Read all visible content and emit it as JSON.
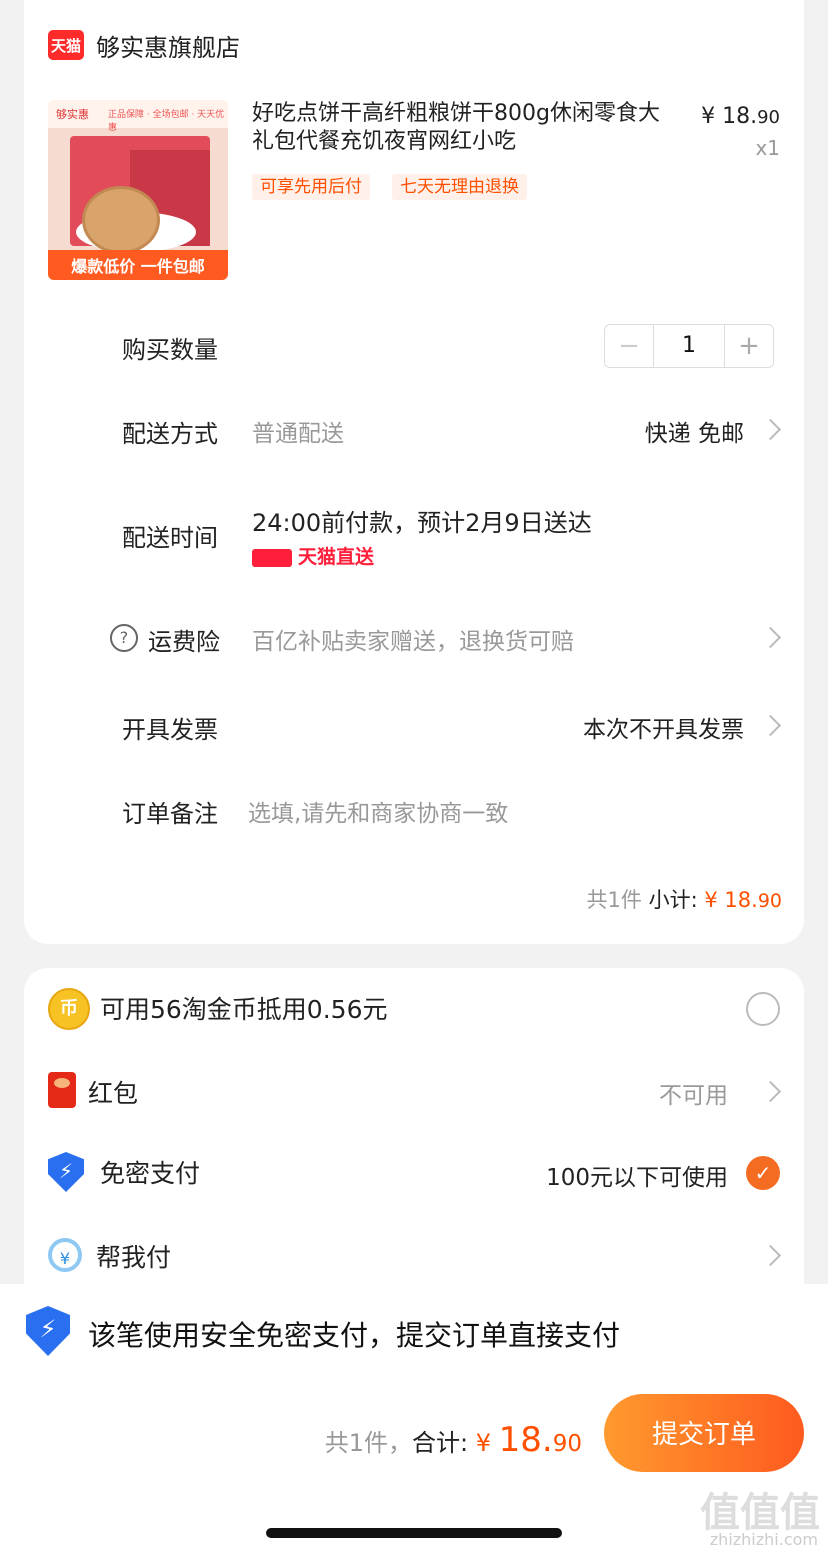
{
  "store": {
    "badge": "天猫",
    "name": "够实惠旗舰店"
  },
  "product": {
    "image_texts": [
      "够实惠",
      "正品保障 · 全场包邮 · 天天优惠",
      "爆款低价  一件包邮"
    ],
    "title": "好吃点饼干高纤粗粮饼干800g休闲零食大礼包代餐充饥夜宵网红小吃",
    "price_int": "¥ 18.",
    "price_dec": "90",
    "quantity": "x1",
    "tags": [
      "可享先用后付",
      "七天无理由退换"
    ]
  },
  "rows": {
    "qty_label": "购买数量",
    "qty_value": "1",
    "qty_minus": "−",
    "qty_plus": "+",
    "delivery_label": "配送方式",
    "delivery_sub": "普通配送",
    "delivery_value": "快递 免邮",
    "time_label": "配送时间",
    "time_value": "24:00前付款，预计2月9日送达",
    "tmall_direct": "天猫直送",
    "insurance_label": "运费险",
    "insurance_sub": "百亿补贴卖家赠送，退换货可赔",
    "invoice_label": "开具发票",
    "invoice_value": "本次不开具发票",
    "remark_label": "订单备注",
    "remark_placeholder": "选填,请先和商家协商一致"
  },
  "subtotal": {
    "count": "共1件",
    "label": "小计:",
    "price_int": "¥ 18.",
    "price_dec": "90"
  },
  "payment": {
    "coin_icon": "币",
    "coin_text": "可用56淘金币抵用0.56元",
    "redpack_label": "红包",
    "redpack_value": "不可用",
    "nopwd_icon": "⚡",
    "nopwd_label": "免密支付",
    "nopwd_value": "100元以下可使用",
    "helpme_icon": "¥",
    "helpme_label": "帮我付"
  },
  "bottom": {
    "notice": "该笔使用安全免密支付，提交订单直接支付",
    "count": "共1件，",
    "total_label": "合计:",
    "currency": "¥ ",
    "total_int": "18.",
    "total_dec": "90",
    "submit": "提交订单"
  },
  "watermark": {
    "main": "值值值",
    "site": "zhizhizhi.com"
  },
  "colors": {
    "accent": "#ff5000",
    "tmall_red": "#ff1f3a",
    "shield_blue": "#2a6ff0"
  }
}
